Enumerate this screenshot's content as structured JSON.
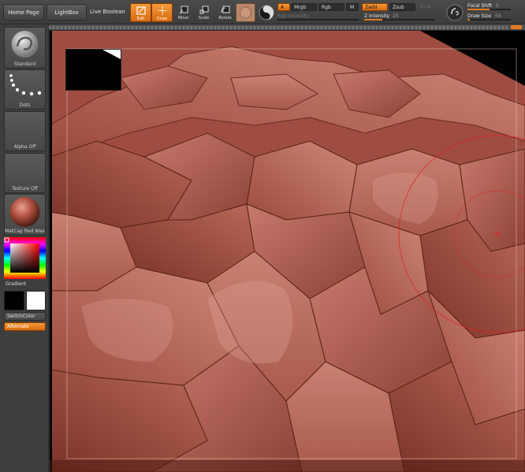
{
  "toolbar": {
    "home_page": "Home Page",
    "lightbox": "LightBox",
    "live_boolean": "Live Boolean",
    "edit": "Edit",
    "draw": "Draw",
    "move": "Move",
    "scale": "Scale",
    "rotate": "Rotate",
    "a_label": "A",
    "mrgb": "Mrgb",
    "rgb": "Rgb",
    "m_label": "M",
    "zadd": "Zadd",
    "zsub": "Zsub",
    "zcut": "Zcut",
    "rgb_intensity": "Rgb Intensity",
    "z_intensity": "Z Intensity",
    "z_intensity_value": "25",
    "z_intensity_fraction": 0.25,
    "focal_shift": "Focal Shift",
    "focal_shift_value": "0",
    "focal_shift_fraction": 0.5,
    "draw_size": "Draw Size",
    "draw_size_value": "64",
    "draw_size_fraction": 0.06
  },
  "shelf": {
    "brush_label": "Standard",
    "stroke_label": "Dots",
    "alpha_label": "Alpha Off",
    "texture_label": "Texture Off",
    "material_label": "MatCap Red Wax",
    "gradient_label": "Gradient",
    "switch_color": "SwitchColor",
    "alternate": "Alternate"
  },
  "colors": {
    "accent": "#e07a1f",
    "clay": "#b05a4c",
    "primary_swatch": "#000000",
    "secondary_swatch": "#ffffff"
  }
}
